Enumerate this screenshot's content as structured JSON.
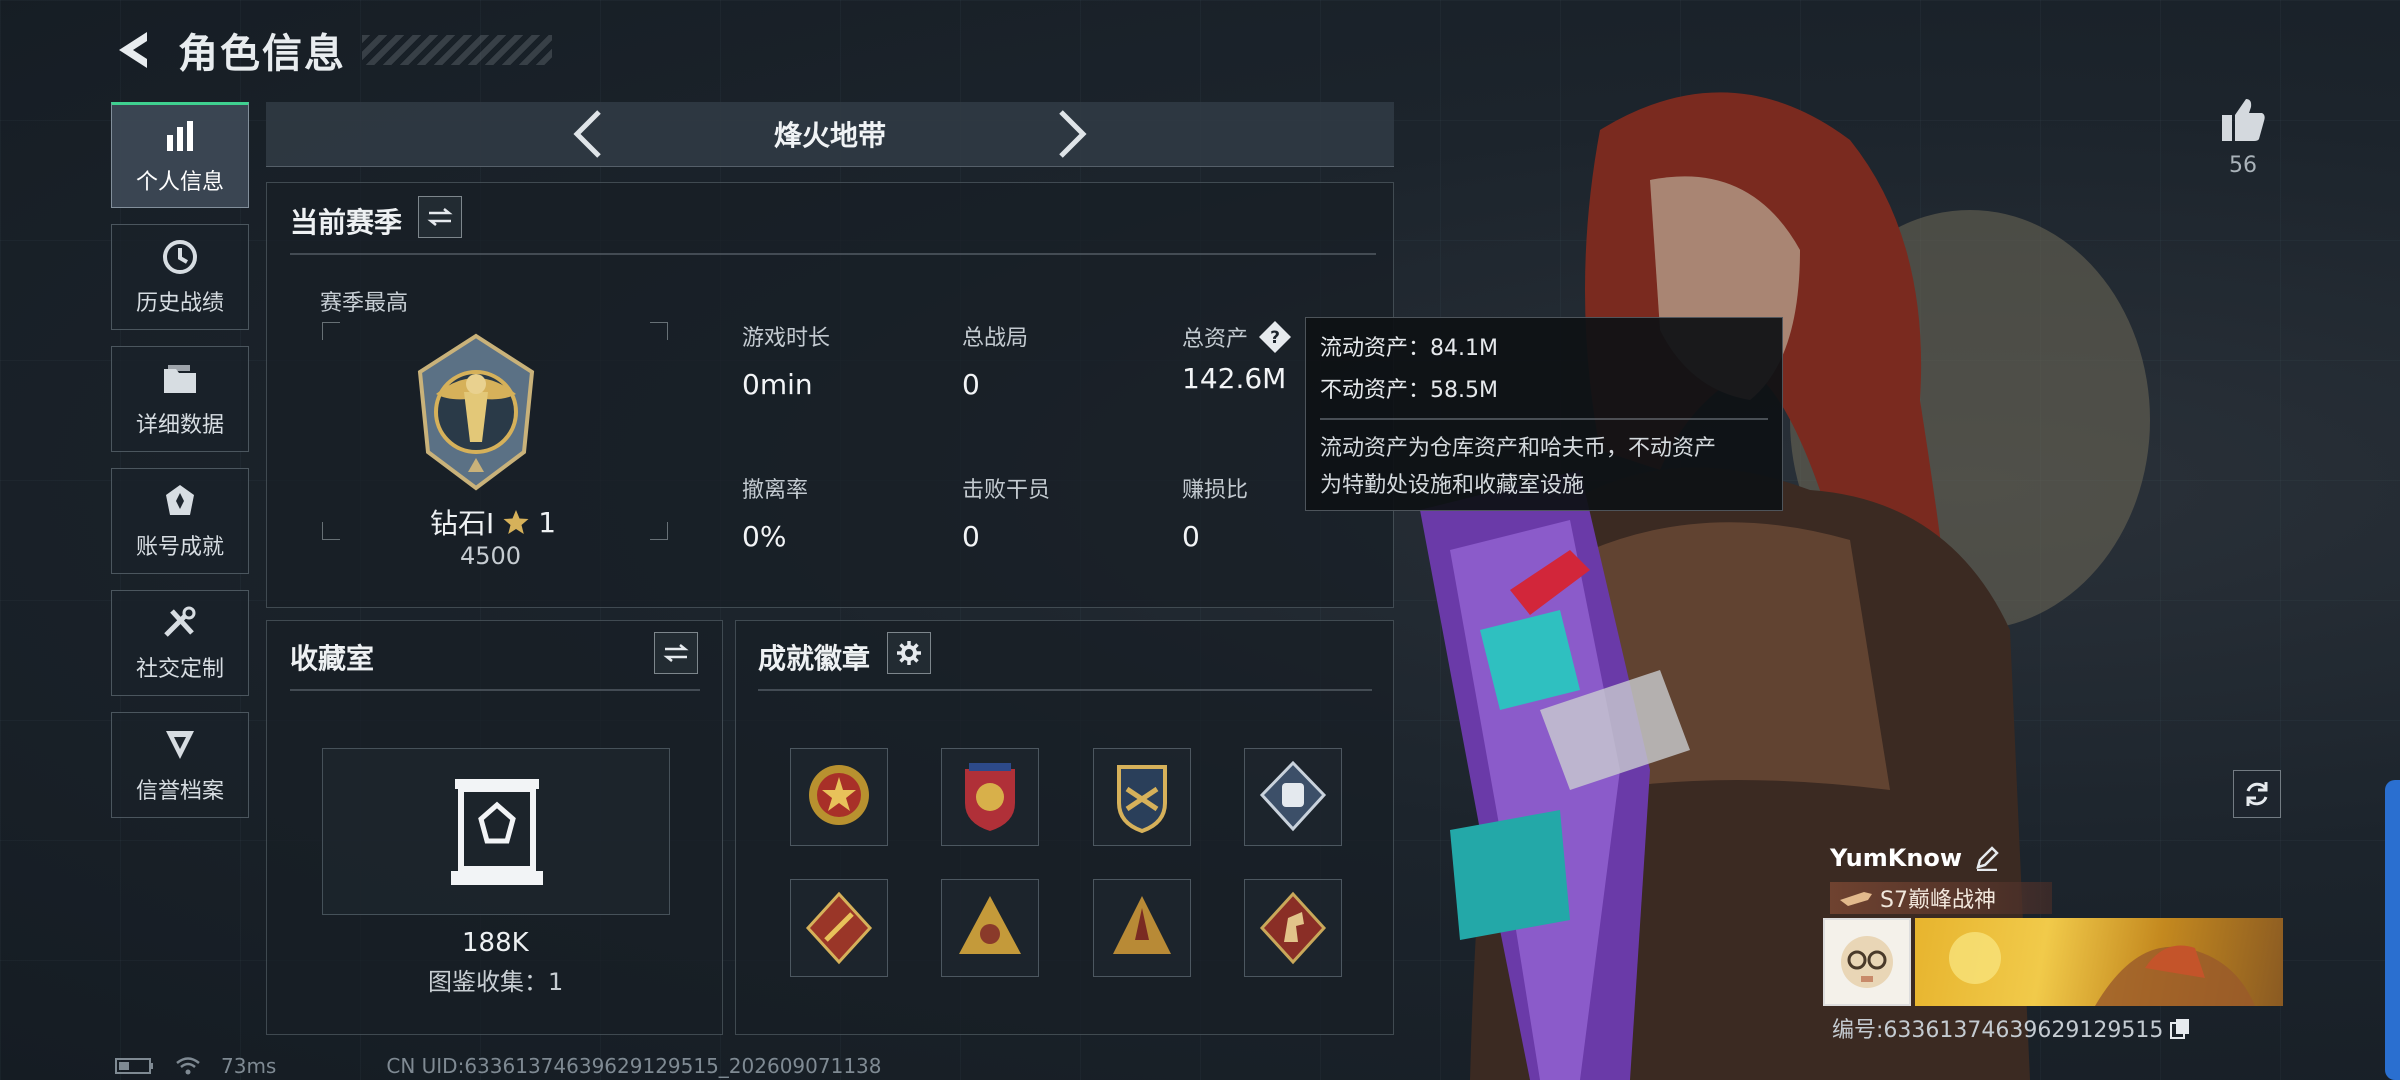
{
  "header": {
    "title": "角色信息"
  },
  "side_menu": [
    {
      "label": "个人信息",
      "icon": "bar-chart-icon",
      "active": true
    },
    {
      "label": "历史战绩",
      "icon": "history-clock-icon",
      "active": false
    },
    {
      "label": "详细数据",
      "icon": "folder-icon",
      "active": false
    },
    {
      "label": "账号成就",
      "icon": "achievement-icon",
      "active": false
    },
    {
      "label": "社交定制",
      "icon": "tools-icon",
      "active": false
    },
    {
      "label": "信誉档案",
      "icon": "reputation-icon",
      "active": false
    }
  ],
  "mode": {
    "name": "烽火地带"
  },
  "season": {
    "title": "当前赛季",
    "best_label": "赛季最高",
    "rank_name": "钻石Ⅰ",
    "rank_stars": "1",
    "rank_score": "4500",
    "stats": [
      {
        "label": "游戏时长",
        "value": "0min"
      },
      {
        "label": "总战局",
        "value": "0"
      },
      {
        "label": "总资产",
        "value": "142.6M"
      },
      {
        "label": "撤离率",
        "value": "0%"
      },
      {
        "label": "击败干员",
        "value": "0"
      },
      {
        "label": "赚损比",
        "value": "0"
      }
    ]
  },
  "tooltip": {
    "liquid": "流动资产：84.1M",
    "fixed": "不动资产：58.5M",
    "desc_line1": "流动资产为仓库资产和哈夫币，不动资产",
    "desc_line2": "为特勤处设施和收藏室设施"
  },
  "collection": {
    "title": "收藏室",
    "value": "188K",
    "count": "图鉴收集：1"
  },
  "badges": {
    "title": "成就徽章"
  },
  "likes": {
    "count": "56"
  },
  "player": {
    "name": "YumKnow",
    "title": "S7巅峰战神",
    "id": "编号:6336137463962912951​5"
  },
  "status": {
    "ping": "73ms",
    "uid": "CN UID:6336137463962912951​5_202609071138"
  },
  "colors": {
    "accent_green": "#3fd090",
    "gold": "#d6b15a",
    "panel_bg": "#181f26"
  }
}
